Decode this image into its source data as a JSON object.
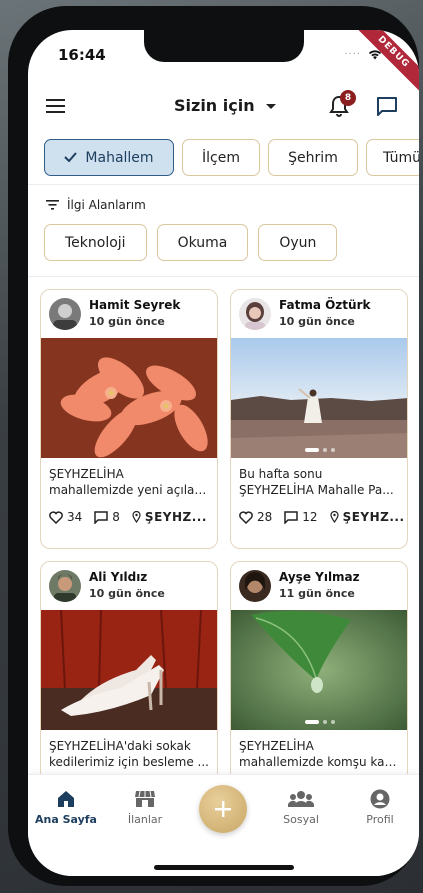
{
  "status_bar": {
    "time": "16:44",
    "signal": "····",
    "debug": "DEBUG"
  },
  "header": {
    "title": "Sizin için",
    "notification_count": "8"
  },
  "scope_chips": [
    {
      "label": "Mahallem",
      "selected": true
    },
    {
      "label": "İlçem",
      "selected": false
    },
    {
      "label": "Şehrim",
      "selected": false
    },
    {
      "label": "Tümü",
      "selected": false
    }
  ],
  "interests": {
    "title": "İlgi Alanlarım",
    "chips": [
      "Teknoloji",
      "Okuma",
      "Oyun"
    ]
  },
  "posts": [
    {
      "author": "Hamit Seyrek",
      "time": "10 gün önce",
      "line1": "ŞEYHZELİHA",
      "line2": "mahallemizde yeni açılan...",
      "likes": "34",
      "comments": "8",
      "location": "ŞEYHZ..."
    },
    {
      "author": "Fatma Öztürk",
      "time": "10 gün önce",
      "line1": "Bu hafta sonu",
      "line2": "ŞEYHZELİHA Mahalle Pa...",
      "likes": "28",
      "comments": "12",
      "location": "ŞEYHZ..."
    },
    {
      "author": "Ali Yıldız",
      "time": "10 gün önce",
      "line1": "ŞEYHZELİHA'daki sokak",
      "line2": "kedilerimiz için besleme ..."
    },
    {
      "author": "Ayşe Yılmaz",
      "time": "11 gün önce",
      "line1": "ŞEYHZELİHA",
      "line2": "mahallemizde komşu kah..."
    }
  ],
  "bottom_nav": [
    {
      "label": "Ana Sayfa",
      "icon": "home-icon",
      "active": true
    },
    {
      "label": "İlanlar",
      "icon": "store-icon",
      "active": false
    },
    {
      "label": "Sosyal",
      "icon": "people-icon",
      "active": false
    },
    {
      "label": "Profil",
      "icon": "profile-icon",
      "active": false
    }
  ],
  "colors": {
    "primary": "#1d3e5e",
    "selected_chip_bg": "#cfe0ef",
    "chip_border": "#d9c7a0",
    "fab": "#c9a766",
    "badge": "#8b1e1e"
  }
}
